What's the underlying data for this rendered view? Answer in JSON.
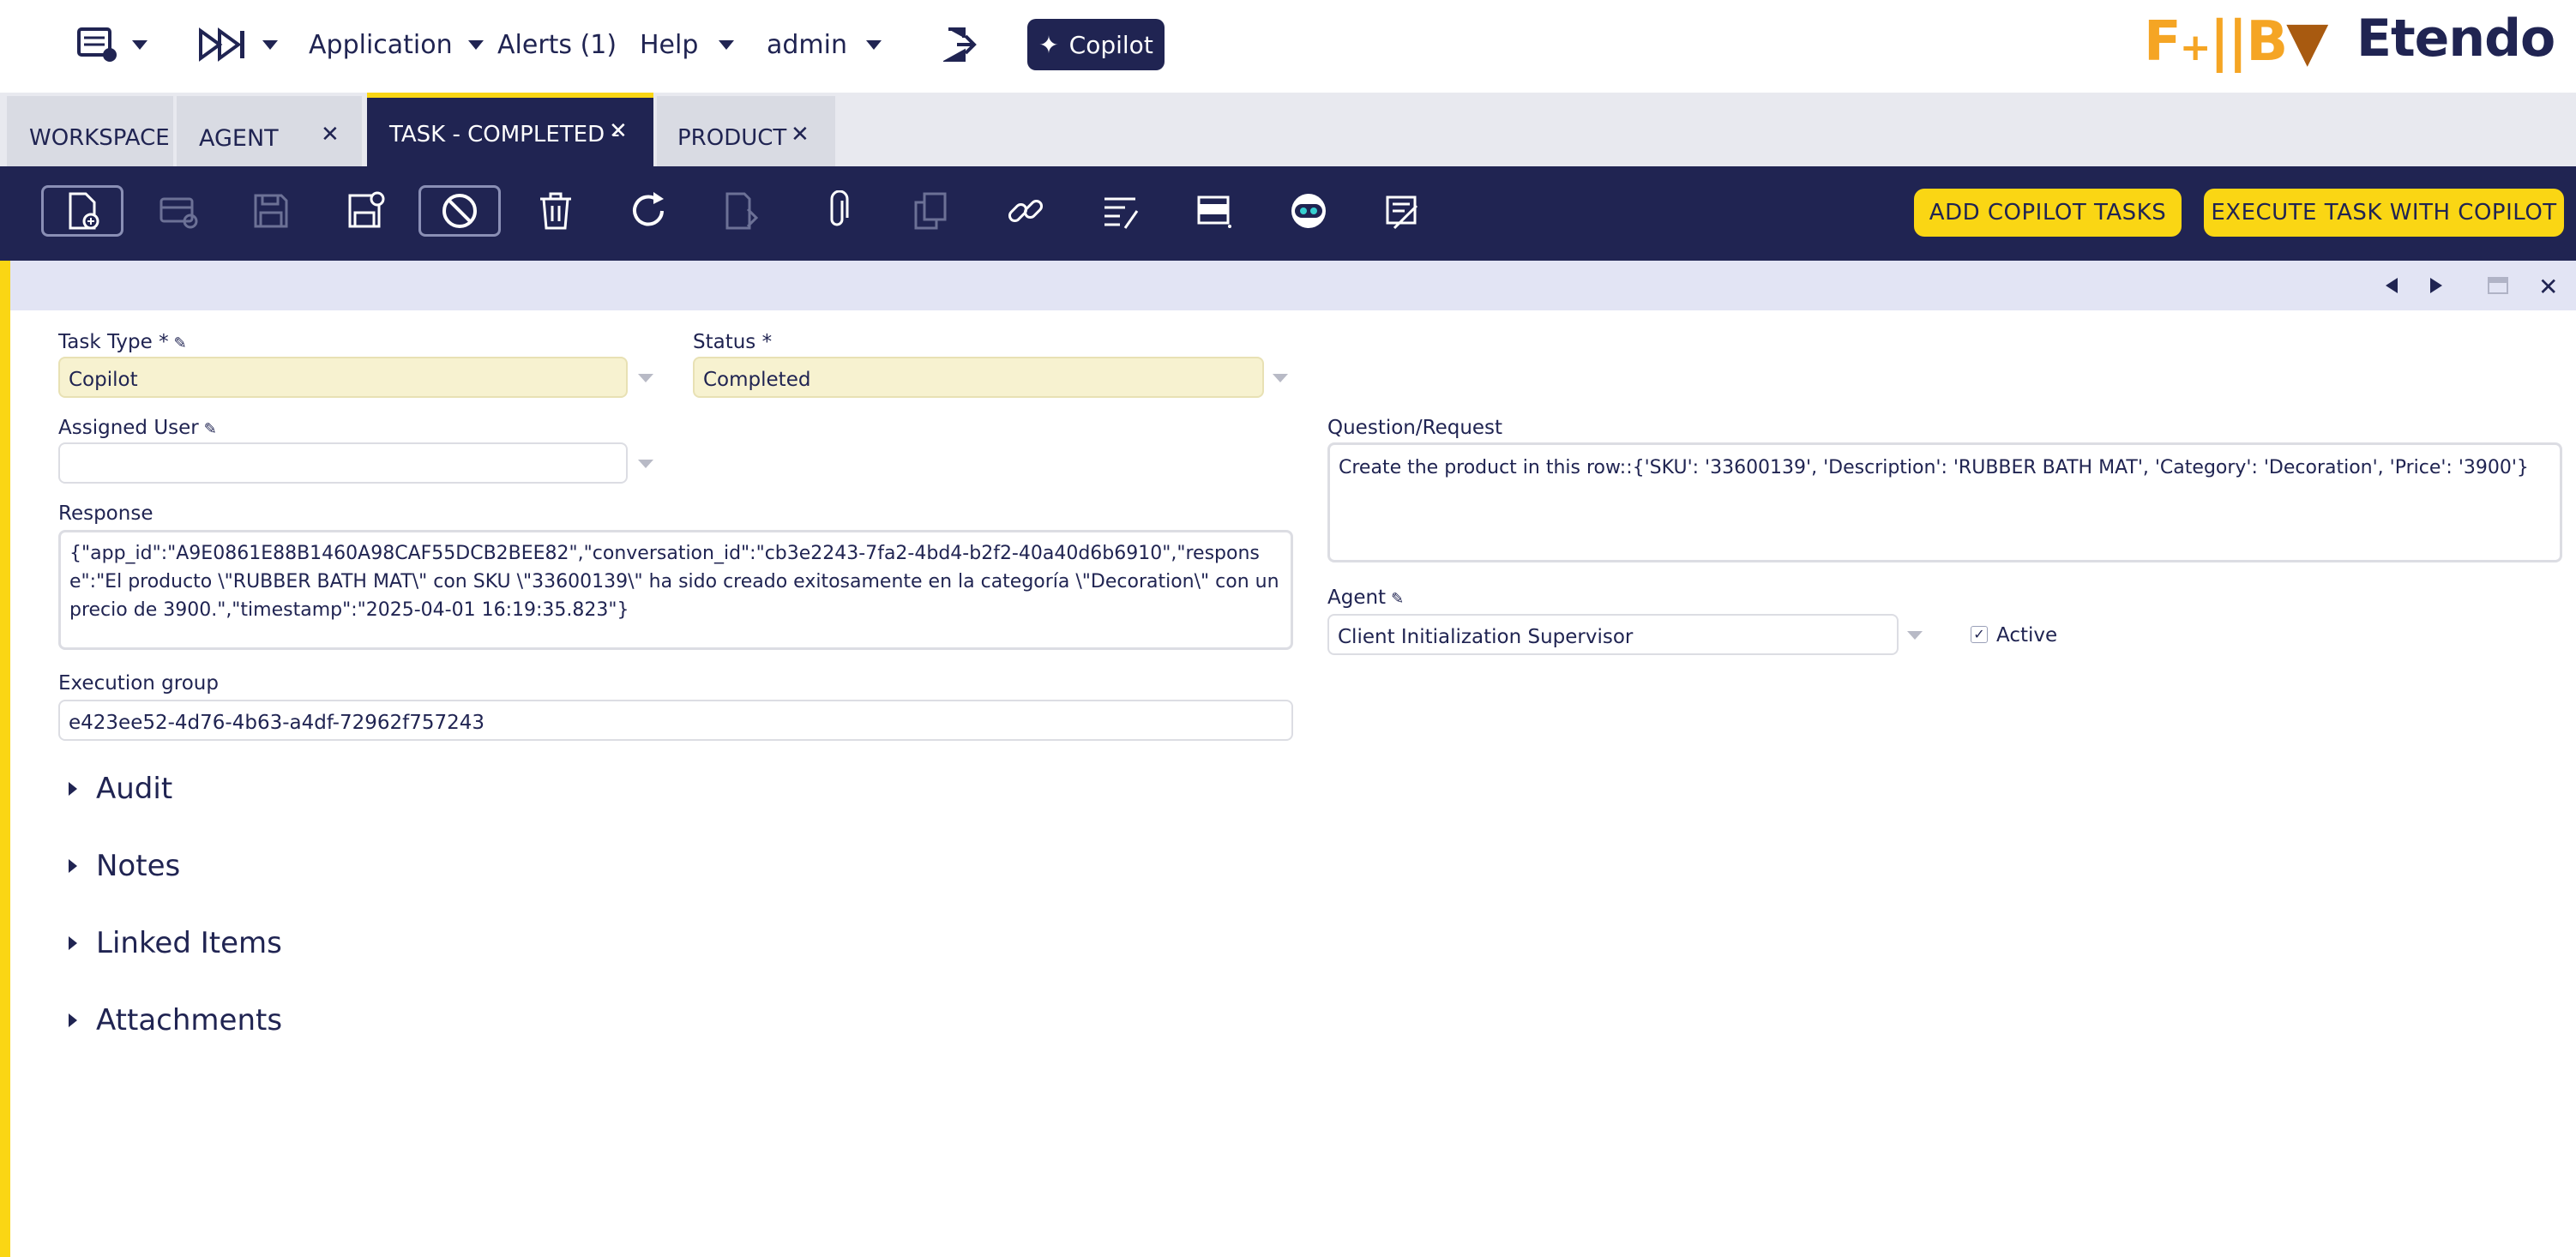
{
  "topbar": {
    "application": "Application",
    "alerts": "Alerts (1)",
    "help": "Help",
    "user": "admin",
    "copilot": "Copilot",
    "logo_left": "F+|B|",
    "logo_right": "Etendo"
  },
  "tabs": [
    {
      "label": "WORKSPACE",
      "closable": false
    },
    {
      "label": "AGENT",
      "closable": true
    },
    {
      "label": "TASK - COMPLETED -",
      "closable": true,
      "active": true
    },
    {
      "label": "PRODUCT",
      "closable": true
    }
  ],
  "toolbar": {
    "icons": [
      "new-record-icon",
      "new-grid-record-icon",
      "save-icon",
      "save-close-icon",
      "undo-icon",
      "delete-icon",
      "refresh-icon",
      "export-icon",
      "attachment-icon",
      "clone-icon",
      "link-icon",
      "audit-icon",
      "form-grid-icon",
      "copilot-bot-icon",
      "notes-icon"
    ],
    "add_tasks": "ADD COPILOT TASKS",
    "execute_task": "EXECUTE TASK WITH COPILOT"
  },
  "form": {
    "task_type_label": "Task Type *",
    "task_type": "Copilot",
    "status_label": "Status *",
    "status": "Completed",
    "assigned_user_label": "Assigned User",
    "assigned_user": "",
    "response_label": "Response",
    "response": "{\"app_id\":\"A9E0861E88B1460A98CAF55DCB2BEE82\",\"conversation_id\":\"cb3e2243-7fa2-4bd4-b2f2-40a40d6b6910\",\"response\":\"El producto \\\"RUBBER BATH MAT\\\" con SKU \\\"33600139\\\" ha sido creado exitosamente en la categoría \\\"Decoration\\\" con un precio de 3900.\",\"timestamp\":\"2025-04-01 16:19:35.823\"}",
    "execution_group_label": "Execution group",
    "execution_group": "e423ee52-4d76-4b63-a4df-72962f757243",
    "question_label": "Question/Request",
    "question": "Create the product in this row::{'SKU': '33600139', 'Description': 'RUBBER BATH MAT', 'Category': 'Decoration', 'Price': '3900'}",
    "agent_label": "Agent",
    "agent": "Client Initialization Supervisor",
    "active_label": "Active",
    "active": true
  },
  "sections": [
    "Audit",
    "Notes",
    "Linked Items",
    "Attachments"
  ],
  "colors": {
    "navy": "#202452",
    "yellow": "#fad614",
    "required_bg": "#f7f2d0",
    "subheader": "#e2e4f4"
  }
}
